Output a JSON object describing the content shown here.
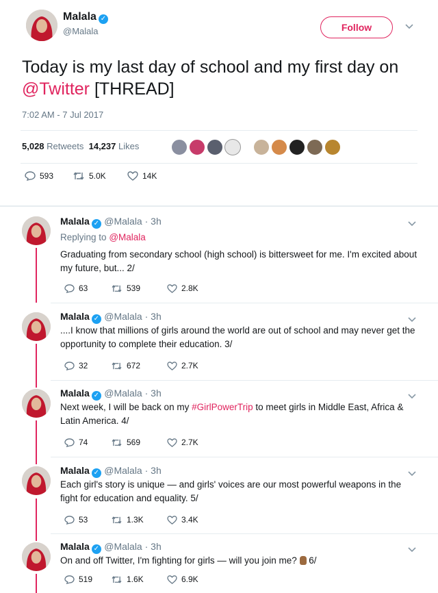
{
  "main": {
    "name": "Malala",
    "handle": "@Malala",
    "follow_label": "Follow",
    "text_before": "Today is my last day of school and my first day on ",
    "text_mention": "@Twitter",
    "text_after": " [THREAD]",
    "timestamp": "7:02 AM - 7 Jul 2017",
    "retweets_count": "5,028",
    "retweets_label": "Retweets",
    "likes_count": "14,237",
    "likes_label": "Likes",
    "replies": "593",
    "retweets_short": "5.0K",
    "likes_short": "14K"
  },
  "replies": [
    {
      "name": "Malala",
      "handle": "@Malala · 3h",
      "replying_label": "Replying to",
      "replying_to": "@Malala",
      "text": "Graduating from secondary school (high school) is bittersweet for me. I'm excited about my future, but... 2/",
      "replies": "63",
      "retweets": "539",
      "likes": "2.8K"
    },
    {
      "name": "Malala",
      "handle": "@Malala · 3h",
      "text": "....I know that millions of girls around the world are out of school and may never get the opportunity to complete their education. 3/",
      "replies": "32",
      "retweets": "672",
      "likes": "2.7K"
    },
    {
      "name": "Malala",
      "handle": "@Malala · 3h",
      "text_before": "Next week, I will be back on my ",
      "hashtag": "#GirlPowerTrip",
      "text_after": " to meet girls in Middle East, Africa & Latin America. 4/",
      "replies": "74",
      "retweets": "569",
      "likes": "2.7K"
    },
    {
      "name": "Malala",
      "handle": "@Malala · 3h",
      "text": "Each girl's story is unique — and girls' voices are our most powerful weapons in the fight for education and equality. 5/",
      "replies": "53",
      "retweets": "1.3K",
      "likes": "3.4K"
    },
    {
      "name": "Malala",
      "handle": "@Malala · 3h",
      "text": "On and off Twitter, I'm fighting for girls — will you join me?",
      "text_end": " 6/",
      "replies": "519",
      "retweets": "1.6K",
      "likes": "6.9K"
    }
  ],
  "colors": {
    "accent": "#e0245e",
    "verified": "#1da1f2",
    "muted": "#657786"
  },
  "icons": [
    "verified-icon",
    "chevron-down-icon",
    "reply-icon",
    "retweet-icon",
    "like-icon",
    "raised-fist-icon"
  ]
}
